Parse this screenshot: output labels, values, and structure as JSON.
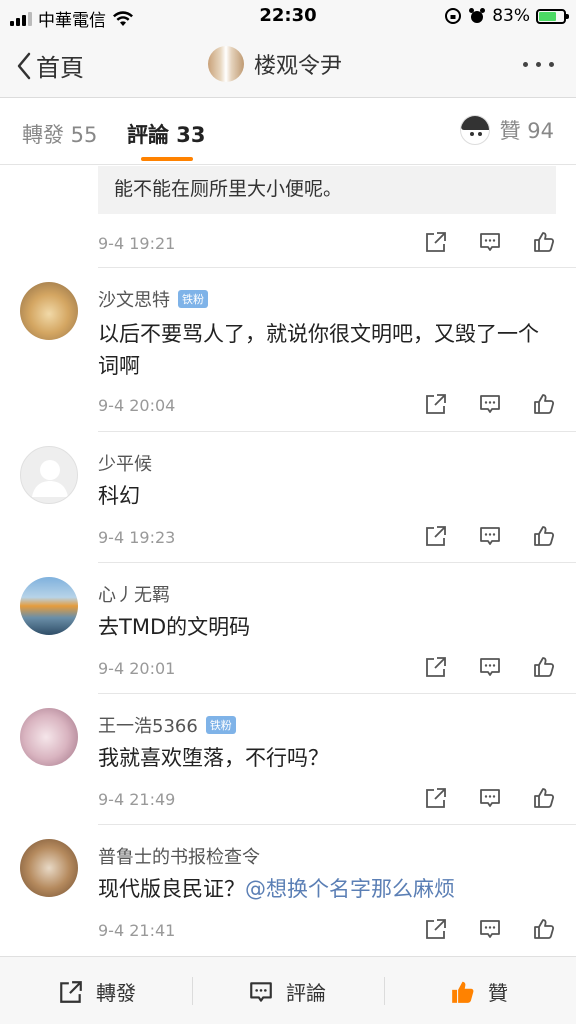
{
  "status_bar": {
    "carrier": "中華電信",
    "time": "22:30",
    "battery": "83%",
    "battery_level": 0.83
  },
  "nav": {
    "back_label": "首頁",
    "title": "楼观令尹"
  },
  "tabs": {
    "repost": "轉發 55",
    "comment": "評論 33",
    "like": "贊 94"
  },
  "quoted": {
    "text": "能不能在厕所里大小便呢。",
    "time": "9-4 19:21"
  },
  "comments": [
    {
      "name": "沙文思特",
      "badge": "铁粉",
      "text": "以后不要骂人了，就说你很文明吧，又毁了一个词啊",
      "time": "9-4 20:04"
    },
    {
      "name": "少平候",
      "badge": "",
      "text": "科幻",
      "time": "9-4 19:23"
    },
    {
      "name": "心丿无羁",
      "badge": "",
      "text": "去TMD的文明码",
      "time": "9-4 20:01"
    },
    {
      "name": "王一浩5366",
      "badge": "铁粉",
      "text": "我就喜欢堕落，不行吗？",
      "time": "9-4 21:49"
    },
    {
      "name": "普鲁士的书报检查令",
      "badge": "",
      "text": "现代版良民证？",
      "mention": "@想换个名字那么麻烦",
      "time": "9-4 21:41"
    }
  ],
  "bottom": {
    "repost": "轉發",
    "comment": "評論",
    "like": "贊"
  },
  "colors": {
    "accent": "#ff8200",
    "mention": "#5b7fb5",
    "badge": "#7fb3e8"
  }
}
